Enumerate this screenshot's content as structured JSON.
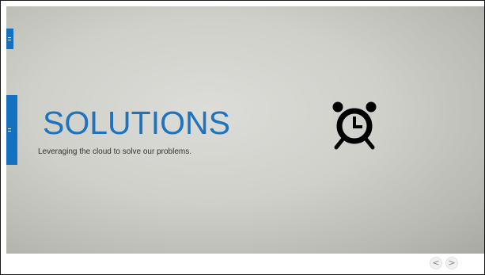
{
  "slide": {
    "title": "SOLUTIONS",
    "subtitle": "Leveraging the cloud to solve our problems.",
    "title_color": "#1e73be",
    "accent_color": "#1570c0",
    "icon": "alarm-clock-icon"
  },
  "navigation": {
    "prev_symbol": "<",
    "next_symbol": ">",
    "prev_icon": "chevron-left-icon",
    "next_icon": "chevron-right-icon"
  }
}
